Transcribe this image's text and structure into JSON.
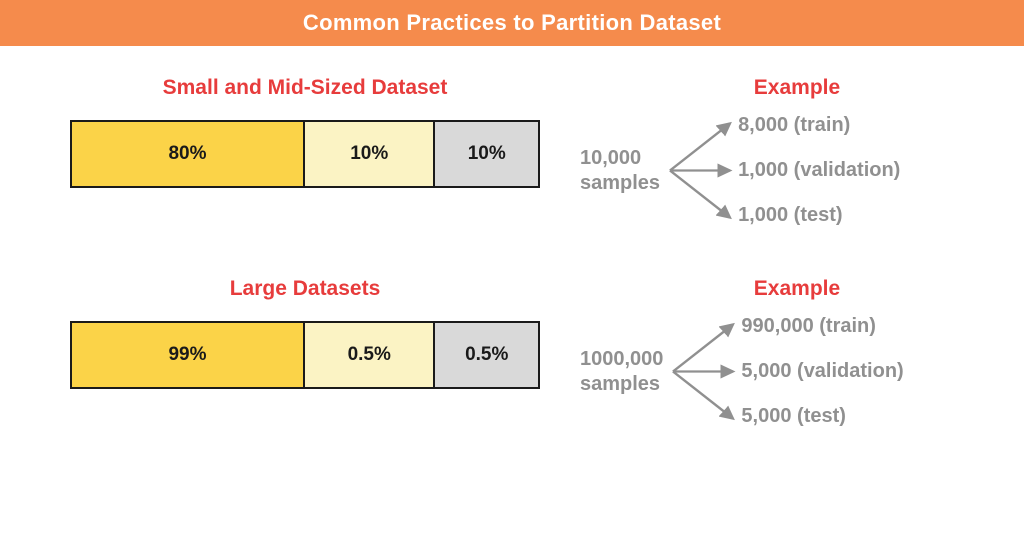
{
  "banner_title": "Common Practices to Partition Dataset",
  "colors": {
    "banner_bg": "#f58b4c",
    "accent_red": "#e73c3c",
    "train_bg": "#fbd348",
    "val_bg": "#fbf3c4",
    "test_bg": "#d9d9d9",
    "muted_gray": "#909090"
  },
  "sections": [
    {
      "title": "Small and Mid-Sized Dataset",
      "example_label": "Example",
      "bar": {
        "segments": [
          {
            "label": "80%",
            "kind": "train",
            "width_pct": 50
          },
          {
            "label": "10%",
            "kind": "val",
            "width_pct": 28
          },
          {
            "label": "10%",
            "kind": "test",
            "width_pct": 22
          }
        ]
      },
      "example": {
        "total_line1": "10,000",
        "total_line2": "samples",
        "splits": [
          "8,000 (train)",
          "1,000 (validation)",
          "1,000 (test)"
        ]
      }
    },
    {
      "title": "Large Datasets",
      "example_label": "Example",
      "bar": {
        "segments": [
          {
            "label": "99%",
            "kind": "train",
            "width_pct": 50
          },
          {
            "label": "0.5%",
            "kind": "val",
            "width_pct": 28
          },
          {
            "label": "0.5%",
            "kind": "test",
            "width_pct": 22
          }
        ]
      },
      "example": {
        "total_line1": "1000,000",
        "total_line2": "samples",
        "splits": [
          "990,000 (train)",
          "5,000 (validation)",
          "5,000 (test)"
        ]
      }
    }
  ],
  "chart_data": [
    {
      "type": "bar",
      "title": "Small and Mid-Sized Dataset",
      "categories": [
        "train",
        "validation",
        "test"
      ],
      "values_pct": [
        80,
        10,
        10
      ],
      "example_total": 10000,
      "example_splits": {
        "train": 8000,
        "validation": 1000,
        "test": 1000
      }
    },
    {
      "type": "bar",
      "title": "Large Datasets",
      "categories": [
        "train",
        "validation",
        "test"
      ],
      "values_pct": [
        99,
        0.5,
        0.5
      ],
      "example_total": 1000000,
      "example_splits": {
        "train": 990000,
        "validation": 5000,
        "test": 5000
      }
    }
  ]
}
